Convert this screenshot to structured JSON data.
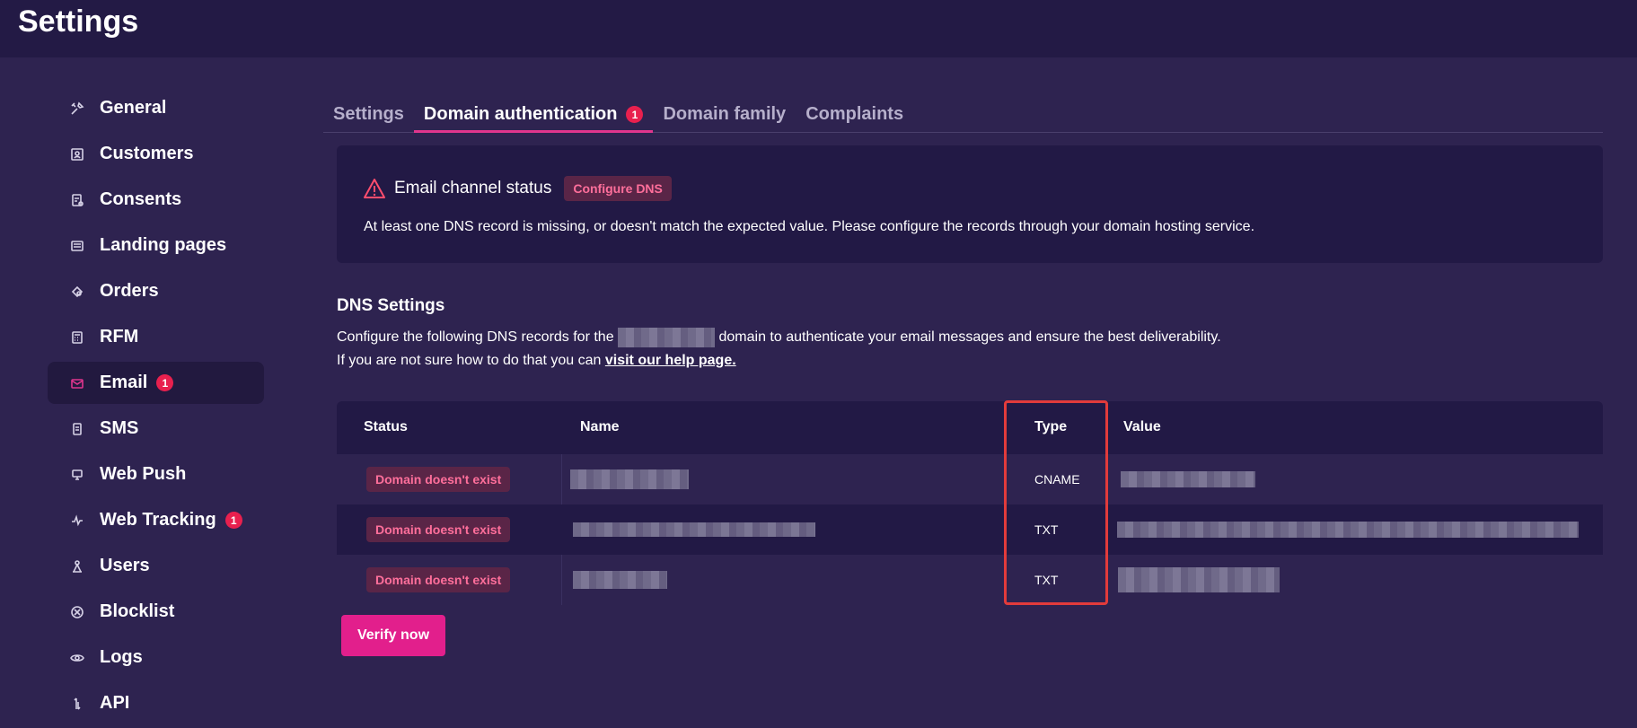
{
  "app": {
    "title": "Settings"
  },
  "sidebar": {
    "items": [
      {
        "label": "General",
        "icon": "tools-icon"
      },
      {
        "label": "Customers",
        "icon": "user-frame-icon"
      },
      {
        "label": "Consents",
        "icon": "consent-icon"
      },
      {
        "label": "Landing pages",
        "icon": "landing-page-icon"
      },
      {
        "label": "Orders",
        "icon": "orders-icon"
      },
      {
        "label": "RFM",
        "icon": "calculator-icon"
      },
      {
        "label": "Email",
        "icon": "envelope-icon",
        "badge": "1",
        "active": true
      },
      {
        "label": "SMS",
        "icon": "phone-icon"
      },
      {
        "label": "Web Push",
        "icon": "web-push-icon"
      },
      {
        "label": "Web Tracking",
        "icon": "pulse-icon",
        "badge": "1"
      },
      {
        "label": "Users",
        "icon": "users-icon"
      },
      {
        "label": "Blocklist",
        "icon": "block-icon"
      },
      {
        "label": "Logs",
        "icon": "eye-icon"
      },
      {
        "label": "API",
        "icon": "api-icon"
      }
    ]
  },
  "tabs": [
    {
      "label": "Settings"
    },
    {
      "label": "Domain authentication",
      "badge": "1",
      "active": true
    },
    {
      "label": "Domain family"
    },
    {
      "label": "Complaints"
    }
  ],
  "status_card": {
    "title": "Email channel status",
    "tag": "Configure DNS",
    "message": "At least one DNS record is missing, or doesn't match the expected value. Please configure the records through your domain hosting service."
  },
  "dns": {
    "title": "DNS Settings",
    "line1_before": "Configure the following DNS records for the",
    "line1_after": "domain to authenticate your email messages and ensure the best deliverability.",
    "line2_before": "If you are not sure how to do that you can",
    "help_link": "visit our help page."
  },
  "table": {
    "headers": {
      "status": "Status",
      "name": "Name",
      "type": "Type",
      "value": "Value"
    },
    "rows": [
      {
        "status": "Domain doesn't exist",
        "type": "CNAME"
      },
      {
        "status": "Domain doesn't exist",
        "type": "TXT"
      },
      {
        "status": "Domain doesn't exist",
        "type": "TXT"
      }
    ]
  },
  "actions": {
    "verify_label": "Verify now"
  },
  "colors": {
    "accent": "#e21f8c",
    "error": "#ff6f9b",
    "highlight": "#e23b3b"
  }
}
